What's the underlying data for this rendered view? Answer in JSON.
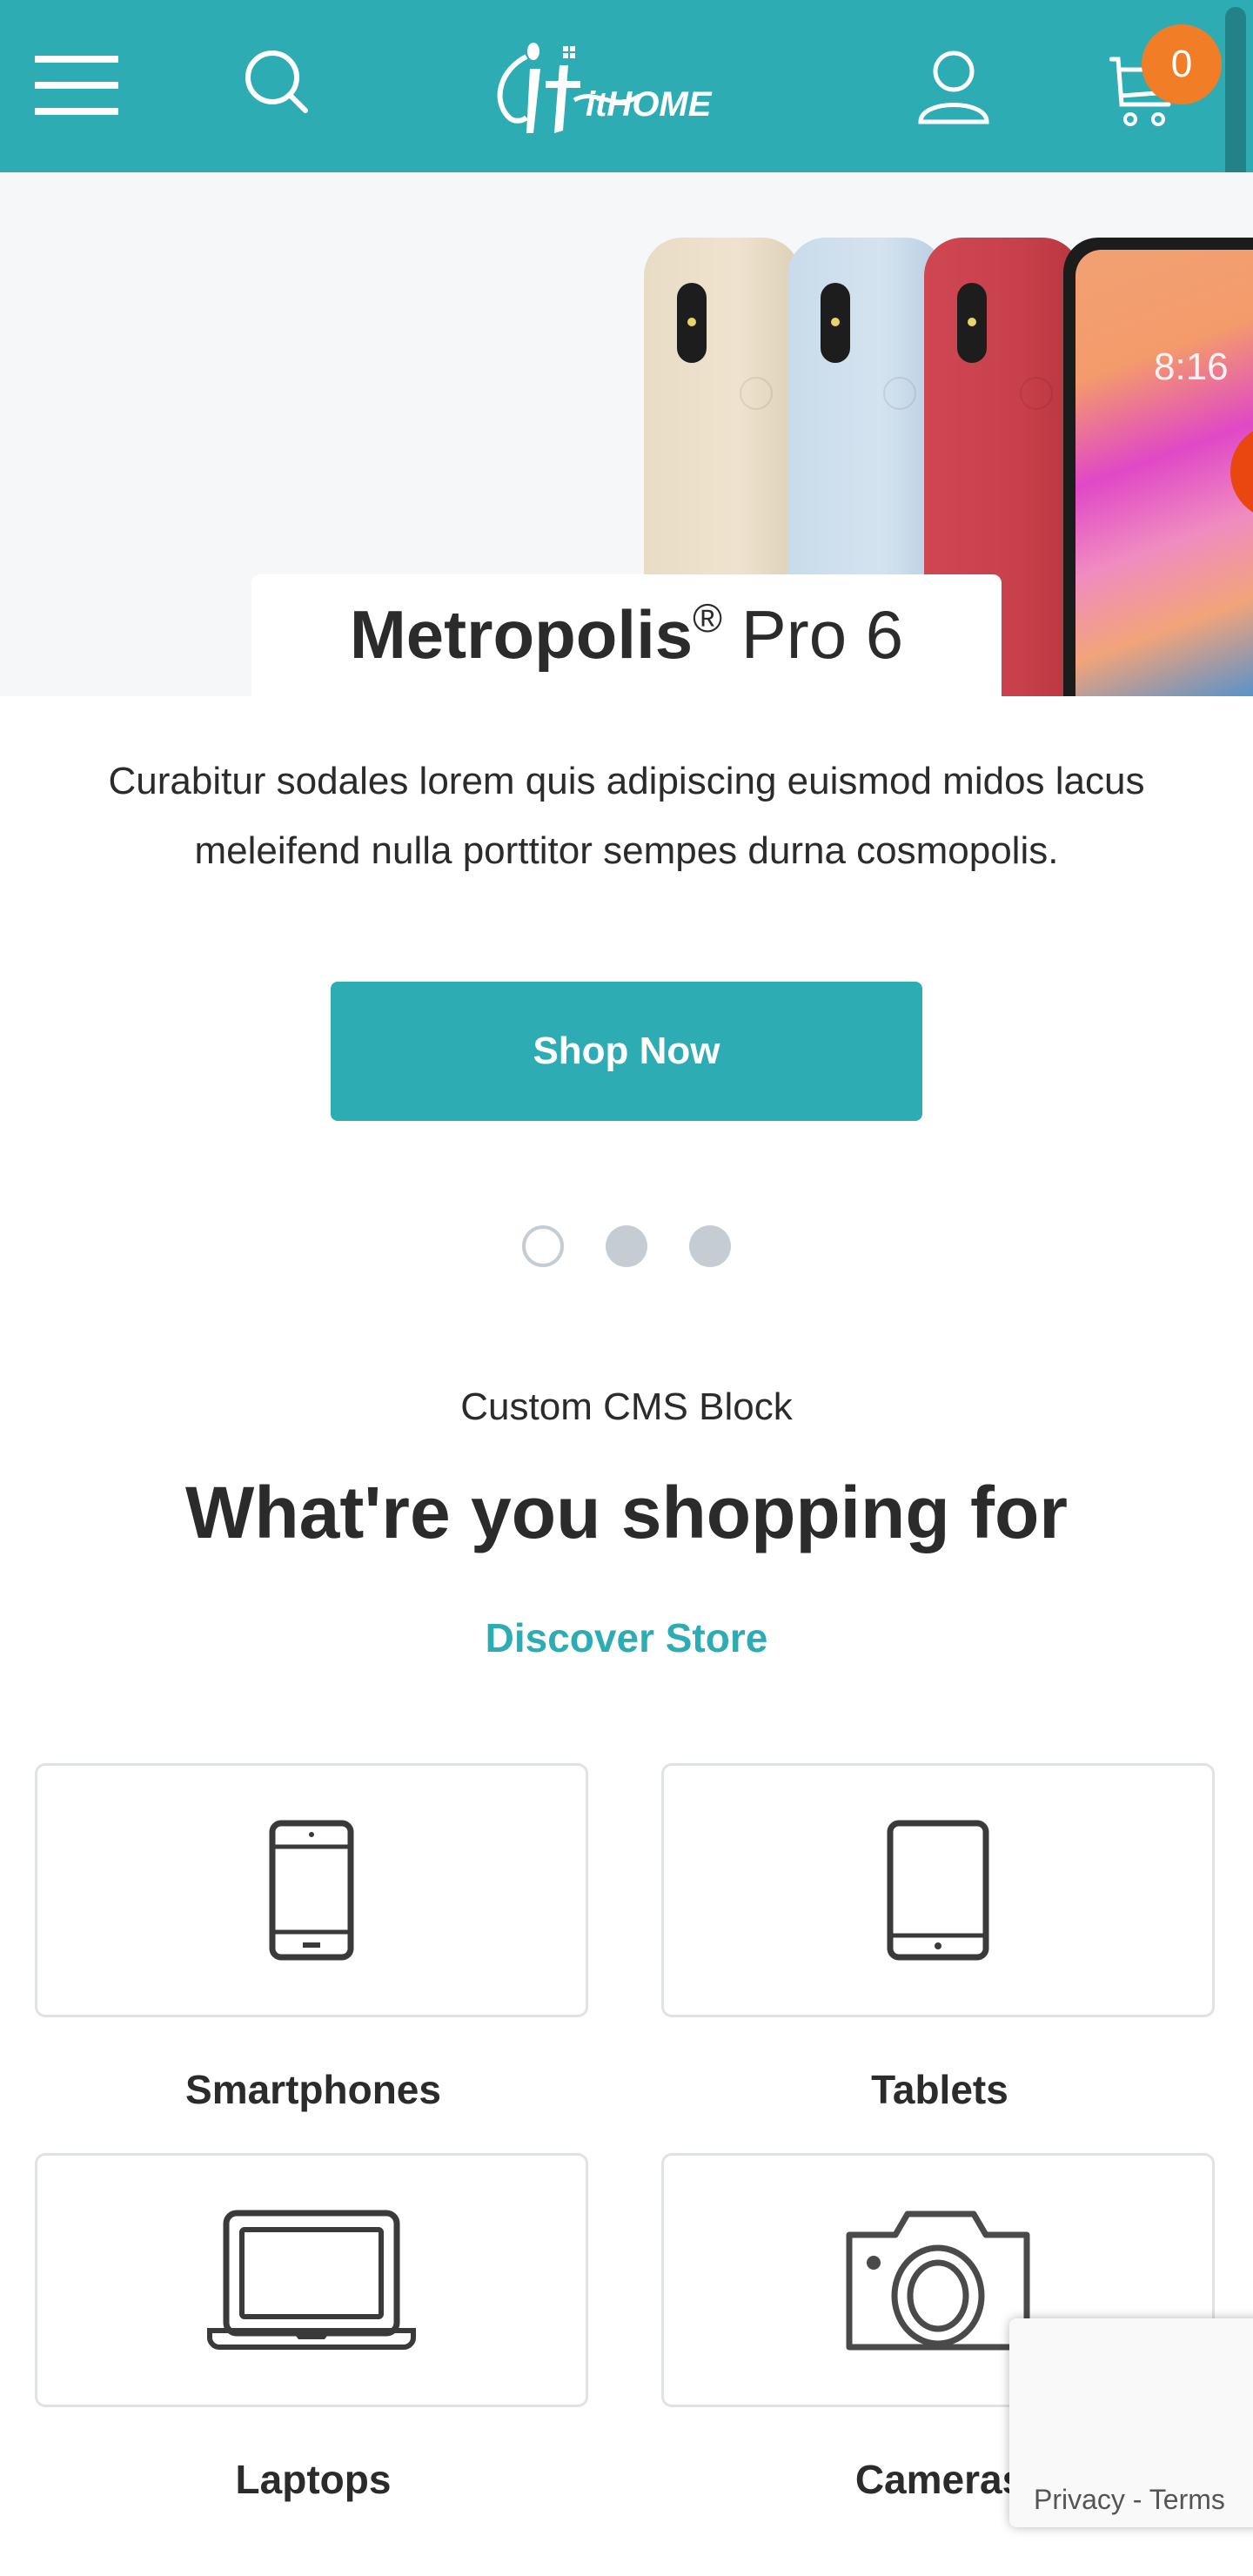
{
  "header": {
    "logo_text": "itHOME",
    "cart_count": "0",
    "colors": {
      "brand": "#2eacb3",
      "badge": "#f27d27"
    },
    "icons": [
      "menu-icon",
      "search-icon",
      "user-icon",
      "cart-icon"
    ]
  },
  "hero": {
    "title_bold": "Metropolis",
    "title_reg_mark": "®",
    "title_rest": " Pro 6",
    "phone_time": "8:16",
    "description": "Curabitur sodales lorem quis adipiscing euismod midos lacus meleifend nulla porttitor sempes durna cosmopolis.",
    "cta_label": "Shop Now",
    "slides": {
      "count": 3,
      "active_index": 0
    }
  },
  "cms": {
    "label": "Custom CMS Block",
    "heading": "What're you shopping for",
    "link_label": "Discover Store"
  },
  "categories": [
    {
      "label": "Smartphones",
      "icon": "smartphone-icon"
    },
    {
      "label": "Tablets",
      "icon": "tablet-icon"
    },
    {
      "label": "Laptops",
      "icon": "laptop-icon"
    },
    {
      "label": "Cameras",
      "icon": "camera-icon"
    }
  ],
  "recaptcha": {
    "privacy_label": "Privacy",
    "separator": " - ",
    "terms_label": "Terms"
  }
}
